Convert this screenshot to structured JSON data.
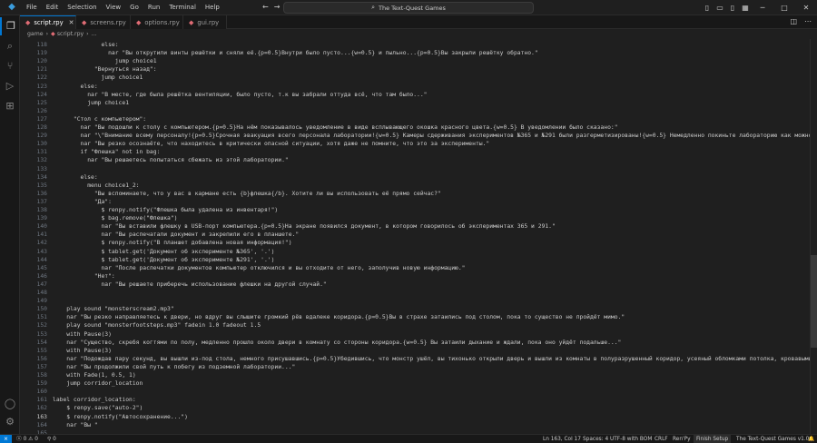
{
  "menu": [
    "File",
    "Edit",
    "Selection",
    "View",
    "Go",
    "Run",
    "Terminal",
    "Help"
  ],
  "search": {
    "text": "The Text-Quest Games"
  },
  "tabs": [
    {
      "label": "script.rpy",
      "active": true
    },
    {
      "label": "screens.rpy",
      "active": false
    },
    {
      "label": "options.rpy",
      "active": false
    },
    {
      "label": "gui.rpy",
      "active": false
    }
  ],
  "breadcrumb": {
    "folder": "game",
    "file": "script.rpy",
    "more": "..."
  },
  "lines": [
    {
      "n": "118",
      "i": 14,
      "t": "else:",
      "c": "kw"
    },
    {
      "n": "119",
      "i": 16,
      "t": "nar \"Вы открутили винты решётки и сняли её.{p=0.5}Внутри было пусто...{w=0.5} и пыльно...{p=0.5}Вы закрыли решётку обратно.\"",
      "c": "str"
    },
    {
      "n": "120",
      "i": 18,
      "t": "jump choice1",
      "c": "kw"
    },
    {
      "n": "121",
      "i": 12,
      "t": "\"Вернуться назад\":",
      "c": "str"
    },
    {
      "n": "122",
      "i": 14,
      "t": "jump choice1",
      "c": "kw"
    },
    {
      "n": "123",
      "i": 8,
      "t": "else:",
      "c": "kw"
    },
    {
      "n": "124",
      "i": 10,
      "t": "nar \"В месте, где была решётка вентиляции, было пусто, т.к вы забрали оттуда всё, что там было...\"",
      "c": "str"
    },
    {
      "n": "125",
      "i": 10,
      "t": "jump choice1",
      "c": "kw"
    },
    {
      "n": "126",
      "i": 0,
      "t": "",
      "c": ""
    },
    {
      "n": "127",
      "i": 6,
      "t": "\"Стол с компьютером\":",
      "c": "str"
    },
    {
      "n": "128",
      "i": 8,
      "t": "nar \"Вы подошли к столу с компьютером.{p=0.5}На нём показывалось уведомление в виде всплывающего окошка красного цвета.{w=0.5} В уведомлении было сказано:\"",
      "c": "str"
    },
    {
      "n": "129",
      "i": 8,
      "t": "nar \"\\\"Внимание всему персоналу!{p=0.5}Срочная эвакуация всего персонала лаборатории!{w=0.5} Камеры сдерживания экспериментов №365 и №291 были разгерметизированы!{w=0.5} Немедленно покиньте лабораторию как можно быстрее!\\\"\"",
      "c": "str"
    },
    {
      "n": "130",
      "i": 8,
      "t": "nar \"Вы резко осознаёте, что находитесь в критически опасной ситуации, хотя даже не помните, что это за эксперименты.\"",
      "c": "str"
    },
    {
      "n": "131",
      "i": 8,
      "t": "if \"Флешка\" not in bag:",
      "c": "kw"
    },
    {
      "n": "132",
      "i": 10,
      "t": "nar \"Вы решаетесь попытаться сбежать из этой лаборатории.\"",
      "c": "str"
    },
    {
      "n": "133",
      "i": 0,
      "t": "",
      "c": ""
    },
    {
      "n": "134",
      "i": 8,
      "t": "else:",
      "c": "kw"
    },
    {
      "n": "135",
      "i": 10,
      "t": "menu choice1_2:",
      "c": "kw"
    },
    {
      "n": "136",
      "i": 12,
      "t": "\"Вы вспоминаете, что у вас в кармане есть {b}флешка{/b}. Хотите ли вы использовать её прямо сейчас?\"",
      "c": "str"
    },
    {
      "n": "137",
      "i": 12,
      "t": "\"Да\":",
      "c": "str"
    },
    {
      "n": "138",
      "i": 14,
      "t": "$ renpy.notify(\"Флешка была удалена из инвентаря!\")",
      "c": "fn"
    },
    {
      "n": "139",
      "i": 14,
      "t": "$ bag.remove(\"Флешка\")",
      "c": "fn"
    },
    {
      "n": "140",
      "i": 14,
      "t": "nar \"Вы вставили флешку в USB-порт компьютера.{p=0.5}На экране появился документ, в котором говорилось об экспериментах 365 и 291.\"",
      "c": "str"
    },
    {
      "n": "141",
      "i": 14,
      "t": "nar \"Вы распечатали документ и закрепили его в планшете.\"",
      "c": "str"
    },
    {
      "n": "142",
      "i": 14,
      "t": "$ renpy.notify(\"В планшет добавлена новая информация!\")",
      "c": "fn"
    },
    {
      "n": "143",
      "i": 14,
      "t": "$ tablet.get('Документ об эксперименте №365', '.')",
      "c": "fn"
    },
    {
      "n": "144",
      "i": 14,
      "t": "$ tablet.get('Документ об эксперименте №291', '.')",
      "c": "fn"
    },
    {
      "n": "145",
      "i": 14,
      "t": "nar \"После распечатки документов компьютер отключился и вы отходите от него, заполучив новую информацию.\"",
      "c": "str"
    },
    {
      "n": "146",
      "i": 12,
      "t": "\"Нет\":",
      "c": "str"
    },
    {
      "n": "147",
      "i": 14,
      "t": "nar \"Вы решаете приберечь использование флешки на другой случай.\"",
      "c": "str"
    },
    {
      "n": "148",
      "i": 0,
      "t": "",
      "c": ""
    },
    {
      "n": "149",
      "i": 0,
      "t": "",
      "c": ""
    },
    {
      "n": "150",
      "i": 4,
      "t": "play sound \"monsterscream2.mp3\"",
      "c": "kw"
    },
    {
      "n": "151",
      "i": 4,
      "t": "nar \"Вы резко направляетесь к двери, но вдруг вы слышите громкий рёв вдалеке коридора.{p=0.5}Вы в страхе затаились под столом, пока то существо не пройдёт мимо.\"",
      "c": "str"
    },
    {
      "n": "152",
      "i": 4,
      "t": "play sound \"monsterfootsteps.mp3\" fadein 1.0 fadeout 1.5",
      "c": "kw"
    },
    {
      "n": "153",
      "i": 4,
      "t": "with Pause(3)",
      "c": "kw"
    },
    {
      "n": "154",
      "i": 4,
      "t": "nar \"Существо, скребя когтями по полу, медленно прошло около двери в комнату со стороны коридора.{w=0.5} Вы затаили дыхание и ждали, пока оно уйдёт подальше...\"",
      "c": "str"
    },
    {
      "n": "155",
      "i": 4,
      "t": "with Pause(3)",
      "c": "kw"
    },
    {
      "n": "156",
      "i": 4,
      "t": "nar \"Подождав пару секунд, вы вышли из-под стола, немного присушавшись.{p=0.5}Убедившись, что монстр ушёл, вы тихонько открыли дверь и вышли из комнаты в полуразрушенный коридор, усеяный обломками потолка, кровавыми пятнами и разбитыми лампами.\"",
      "c": "str"
    },
    {
      "n": "157",
      "i": 4,
      "t": "nar \"Вы продолжили свой путь к побегу из подземной лаборатории...\"",
      "c": "str"
    },
    {
      "n": "158",
      "i": 4,
      "t": "with Fade(1, 0.5, 1)",
      "c": "kw"
    },
    {
      "n": "159",
      "i": 4,
      "t": "jump corridor_location",
      "c": "kw"
    },
    {
      "n": "160",
      "i": 0,
      "t": "",
      "c": ""
    },
    {
      "n": "161",
      "i": 0,
      "t": "label corridor_location:",
      "c": "kw"
    },
    {
      "n": "162",
      "i": 4,
      "t": "$ renpy.save(\"auto-2\")",
      "c": "fn"
    },
    {
      "n": "163",
      "i": 4,
      "t": "$ renpy.notify(\"Автосохранение...\")",
      "c": "fn"
    },
    {
      "n": "164",
      "i": 4,
      "t": "nar \"Вы \"",
      "c": "str"
    },
    {
      "n": "165",
      "i": 0,
      "t": "",
      "c": ""
    },
    {
      "n": "166",
      "i": 0,
      "t": "return",
      "c": "kw"
    }
  ],
  "cursor_line": "163",
  "status": {
    "problems": "ⓧ 0 ⚠ 0",
    "ports": "⚲ 0",
    "position": "Ln 163, Col 17",
    "spaces": "Spaces: 4",
    "encoding": "UTF-8 with BOM",
    "eol": "CRLF",
    "language": "Ren'Py",
    "finish_setup": "Finish Setup",
    "extension": "The Text-Quest Games v1.0"
  },
  "colors": {
    "accent": "#0078d4",
    "editor_bg": "#1f1f1f",
    "keyword": "#569cd6",
    "string": "#ce9178",
    "function": "#dcdcaa"
  }
}
